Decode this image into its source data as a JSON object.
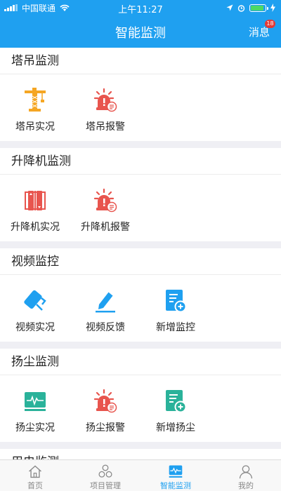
{
  "status_bar": {
    "carrier": "中国联通",
    "time": "上午11:27"
  },
  "header": {
    "title": "智能监测",
    "messages_label": "消息",
    "messages_badge": "18"
  },
  "sections": [
    {
      "title": "塔吊监测",
      "items": [
        {
          "label": "塔吊实况",
          "icon": "tower-crane-icon"
        },
        {
          "label": "塔吊报警",
          "icon": "alarm-light-icon"
        }
      ]
    },
    {
      "title": "升降机监测",
      "items": [
        {
          "label": "升降机实况",
          "icon": "elevator-icon"
        },
        {
          "label": "升降机报警",
          "icon": "alarm-light-icon"
        }
      ]
    },
    {
      "title": "视频监控",
      "items": [
        {
          "label": "视频实况",
          "icon": "camera-icon"
        },
        {
          "label": "视频反馈",
          "icon": "pen-icon"
        },
        {
          "label": "新增监控",
          "icon": "add-document-icon"
        }
      ]
    },
    {
      "title": "扬尘监测",
      "items": [
        {
          "label": "扬尘实况",
          "icon": "monitor-icon"
        },
        {
          "label": "扬尘报警",
          "icon": "alarm-light-icon"
        },
        {
          "label": "新增扬尘",
          "icon": "add-document-icon"
        }
      ]
    },
    {
      "title": "用电监测"
    }
  ],
  "tabbar": [
    {
      "label": "首页",
      "icon": "home-icon"
    },
    {
      "label": "项目管理",
      "icon": "project-icon"
    },
    {
      "label": "智能监测",
      "icon": "monitor-icon",
      "active": true
    },
    {
      "label": "我的",
      "icon": "user-icon"
    }
  ],
  "colors": {
    "primary": "#1fa0f0",
    "orange": "#f5a623",
    "red": "#e8554e",
    "teal": "#2ab29a"
  }
}
